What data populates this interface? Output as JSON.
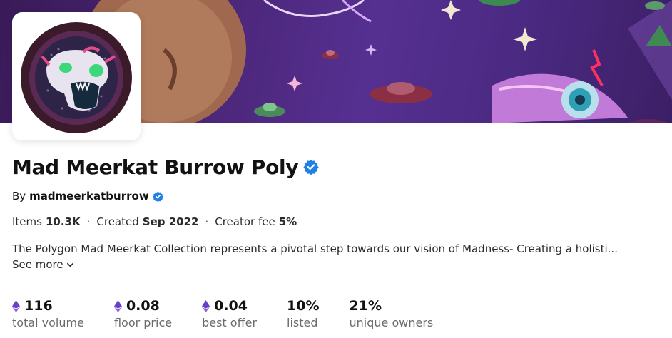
{
  "collection": {
    "title": "Mad Meerkat Burrow Poly",
    "by_label": "By",
    "creator": "madmeerkatburrow",
    "verified": true
  },
  "meta": {
    "items_label": "Items",
    "items_value": "10.3K",
    "created_label": "Created",
    "created_value": "Sep 2022",
    "fee_label": "Creator fee",
    "fee_value": "5%",
    "separator": "·"
  },
  "description": {
    "text": "The Polygon Mad Meerkat Collection represents a pivotal step towards our vision of Madness- Creating a holisti...",
    "see_more": "See more"
  },
  "stats": [
    {
      "value": "116",
      "label": "total volume",
      "currency_icon": "eth-icon"
    },
    {
      "value": "0.08",
      "label": "floor price",
      "currency_icon": "eth-icon"
    },
    {
      "value": "0.04",
      "label": "best offer",
      "currency_icon": "eth-icon"
    },
    {
      "value": "10%",
      "label": "listed"
    },
    {
      "value": "21%",
      "label": "unique owners"
    }
  ],
  "colors": {
    "verified_blue": "#2081e2",
    "eth_purple": "#6a3fc8",
    "banner_purple": "#4a2576"
  }
}
